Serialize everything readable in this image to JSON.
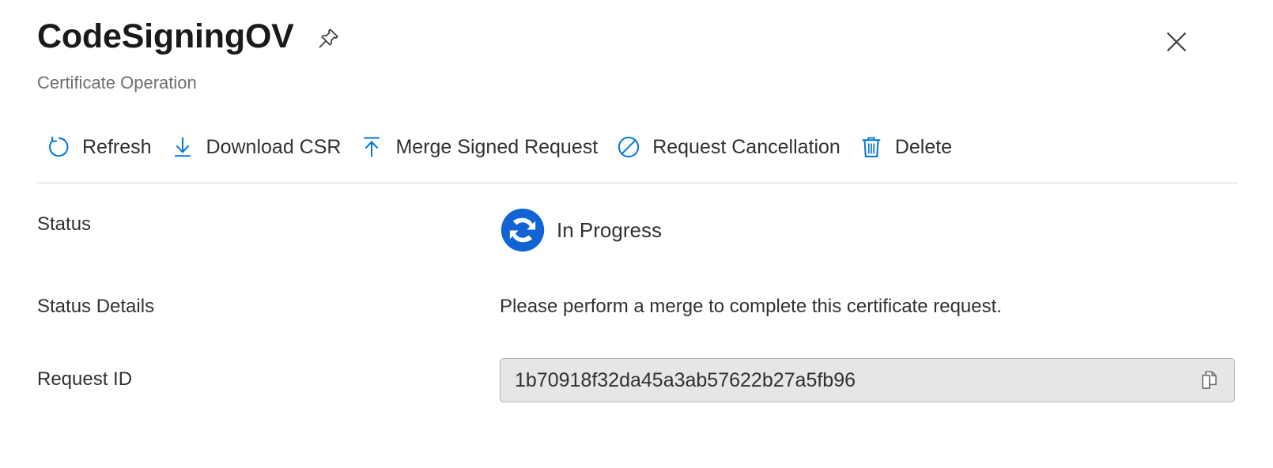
{
  "header": {
    "title": "CodeSigningOV",
    "subtitle": "Certificate Operation",
    "pin_tooltip": "Pin to dashboard",
    "close_tooltip": "Close"
  },
  "toolbar": {
    "commands": [
      {
        "label": "Refresh",
        "icon": "refresh-icon"
      },
      {
        "label": "Download CSR",
        "icon": "download-icon"
      },
      {
        "label": "Merge Signed Request",
        "icon": "upload-icon"
      },
      {
        "label": "Request Cancellation",
        "icon": "prohibition-icon"
      },
      {
        "label": "Delete",
        "icon": "trash-icon"
      }
    ]
  },
  "properties": {
    "status": {
      "label": "Status",
      "value": "In Progress",
      "icon": "in-progress-sync-icon"
    },
    "status_details": {
      "label": "Status Details",
      "value": "Please perform a merge to complete this certificate request."
    },
    "request_id": {
      "label": "Request ID",
      "value": "1b70918f32da45a3ab57622b27a5fb96",
      "copy_tooltip": "Copy to clipboard"
    }
  },
  "colors": {
    "accent_blue": "#0078d4",
    "status_blue": "#1264d4",
    "text_primary": "#323130",
    "text_secondary": "#6e6e6e",
    "divider": "#d6d6d6",
    "field_bg": "#e6e6e6",
    "field_border": "#b3b3b3"
  }
}
